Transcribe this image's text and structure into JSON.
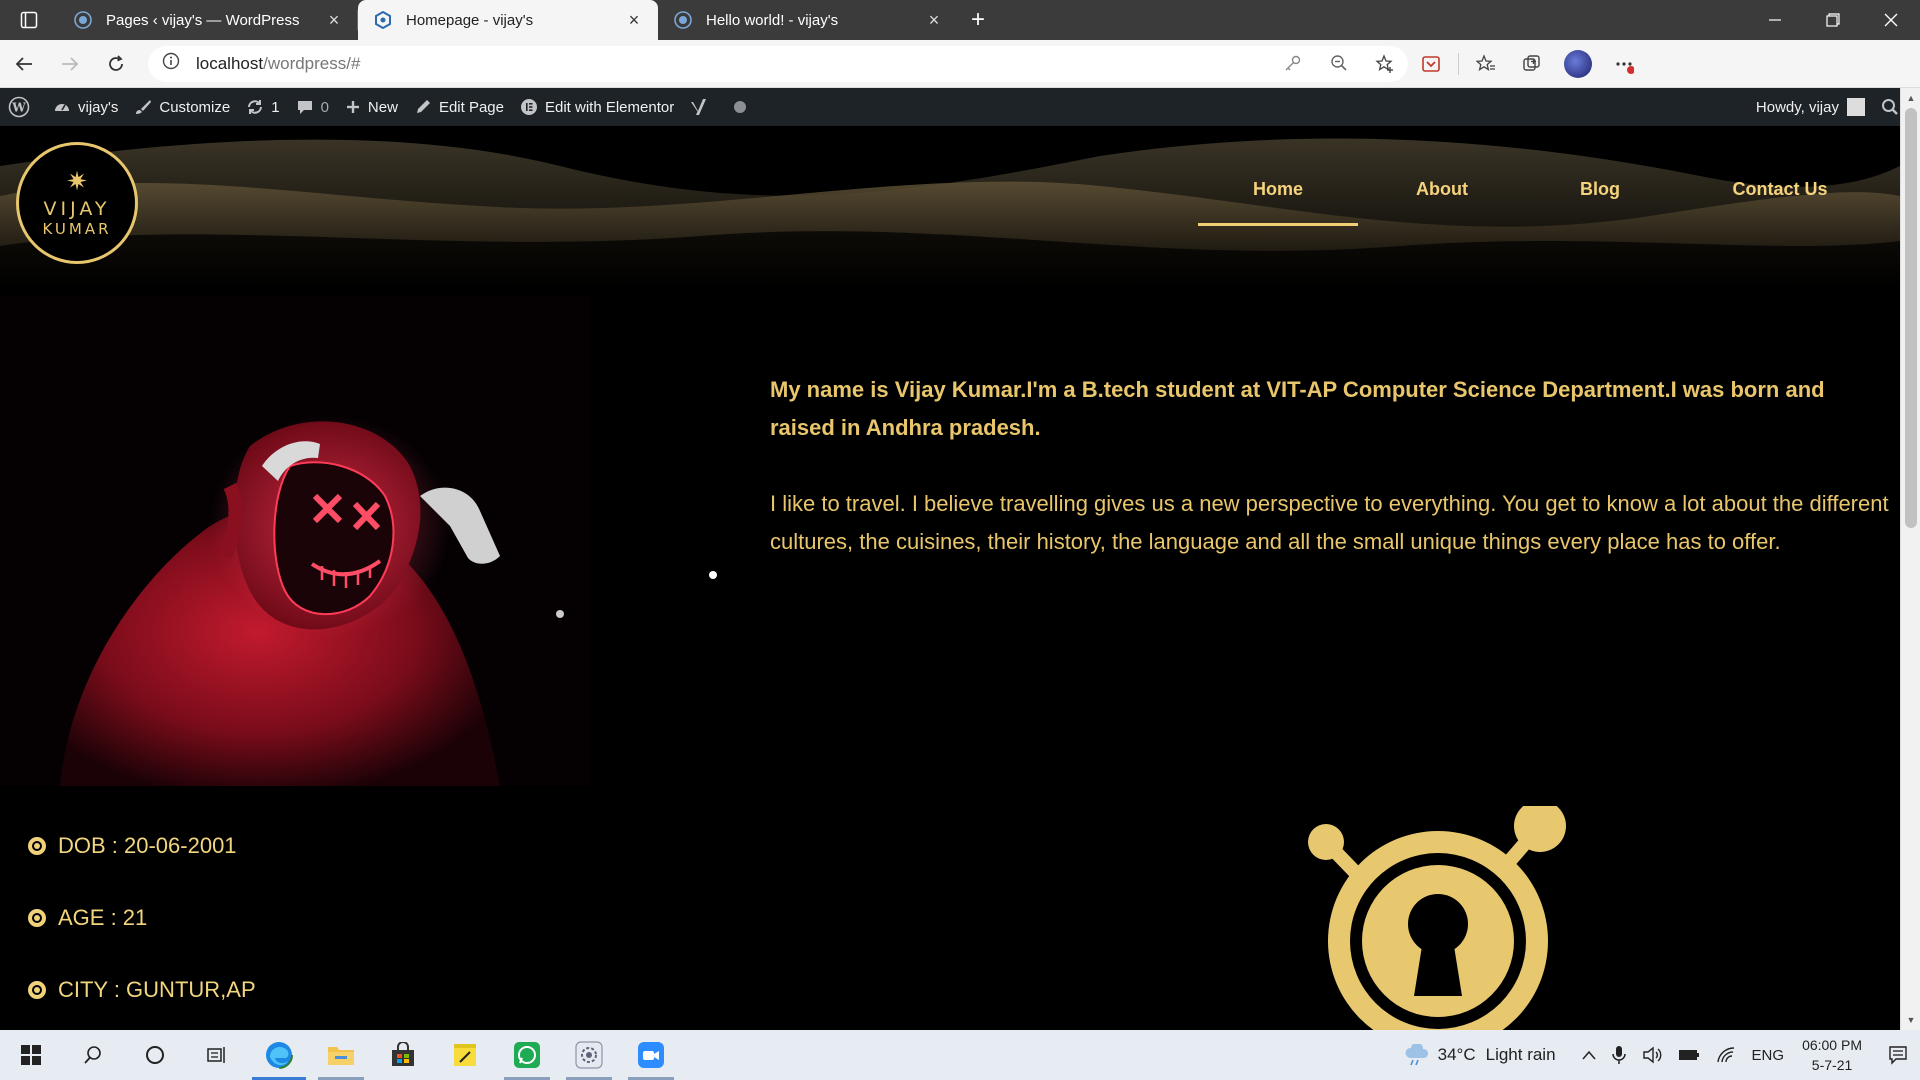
{
  "browser": {
    "tabs": [
      {
        "title": "Pages ‹ vijay's — WordPress",
        "active": false
      },
      {
        "title": "Homepage - vijay's",
        "active": true
      },
      {
        "title": "Hello world! - vijay's",
        "active": false
      }
    ],
    "url_host": "localhost",
    "url_path": "/wordpress/#"
  },
  "wpbar": {
    "site": "vijay's",
    "customize": "Customize",
    "updates": "1",
    "comments": "0",
    "new": "New",
    "edit_page": "Edit Page",
    "edit_elementor": "Edit with Elementor",
    "howdy": "Howdy, vijay"
  },
  "logo": {
    "line1": "VIJAY",
    "line2": "KUMAR"
  },
  "nav": [
    {
      "label": "Home",
      "active": true
    },
    {
      "label": "About",
      "active": false
    },
    {
      "label": "Blog",
      "active": false
    },
    {
      "label": "Contact Us",
      "active": false
    }
  ],
  "about": {
    "intro": "My name is Vijay Kumar.I'm a B.tech student at VIT-AP Computer Science Department.I was born and raised in Andhra pradesh.",
    "travel": "I like to travel. I believe travelling gives us a new perspective to everything. You get to know a lot about the different cultures, the cuisines, their history, the language and all the small unique things every place has to offer."
  },
  "facts": [
    "DOB : 20-06-2001",
    "AGE : 21",
    "CITY : GUNTUR,AP"
  ],
  "taskbar": {
    "weather_temp": "34°C",
    "weather_desc": "Light rain",
    "lang": "ENG",
    "time": "06:00 PM",
    "date": "5-7-21"
  },
  "colors": {
    "accent_gold": "#e9c66b",
    "wp_admin_bar": "#1d2327",
    "page_bg": "#000000"
  }
}
